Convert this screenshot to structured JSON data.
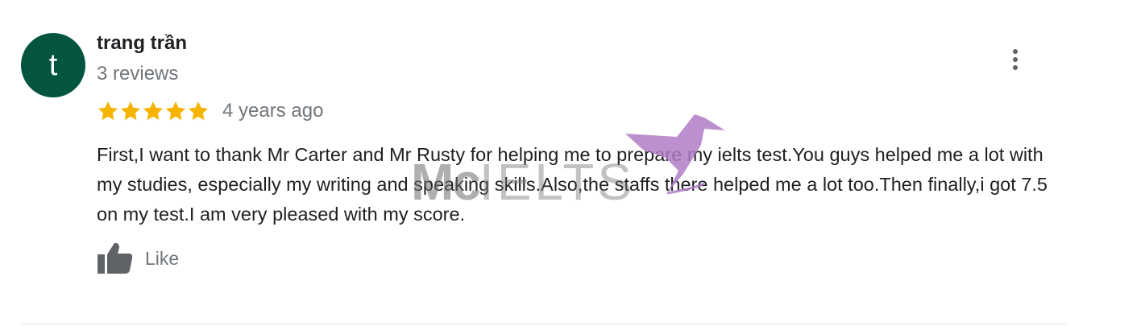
{
  "review": {
    "avatar_letter": "t",
    "avatar_color": "#045540",
    "author_name": "trang trần",
    "review_count": "3 reviews",
    "rating": 5,
    "rating_max": 5,
    "star_color": "#f6b400",
    "date": "4 years ago",
    "text": "First,I want to thank Mr Carter and Mr Rusty for helping me to prepare my ielts test.You guys helped me a lot with my studies, especially my writing and speaking skills.Also,the staffs there helped me a lot too.Then finally,i got 7.5 on my test.I am very pleased with my score.",
    "like_label": "Like",
    "more_icon": "more-vert-icon",
    "like_icon": "thumbs-up-icon"
  },
  "watermark": {
    "text_bold": "Mc",
    "text_light": "IELTS",
    "bird_color": "#b07cc6"
  }
}
